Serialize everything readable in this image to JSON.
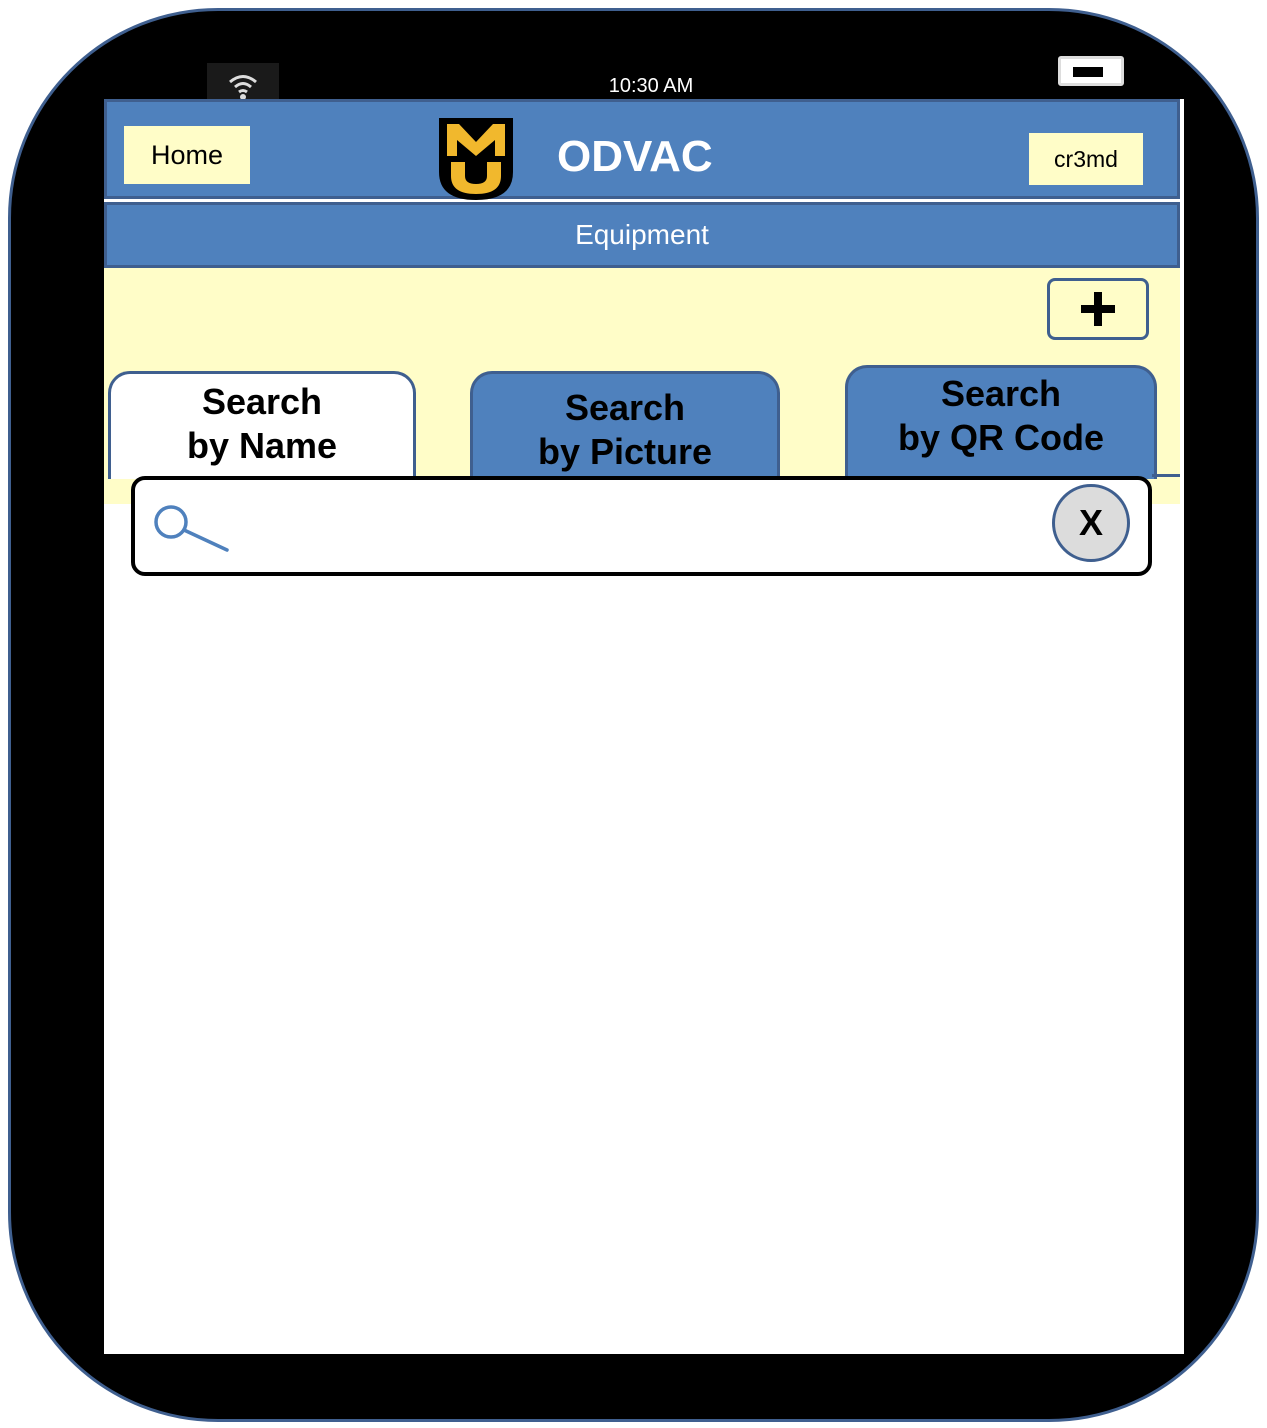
{
  "status_bar": {
    "time": "10:30 AM",
    "wifi_icon": "wifi-icon",
    "battery_icon": "battery-icon"
  },
  "header": {
    "home_label": "Home",
    "logo_icon": "mu-logo-icon",
    "logo_text": "MU",
    "title": "ODVAC",
    "user_label": "cr3md"
  },
  "subheader": {
    "title": "Equipment"
  },
  "toolbar": {
    "add_icon": "plus-icon"
  },
  "tabs": [
    {
      "line1": "Search",
      "line2": "by Name",
      "active": true
    },
    {
      "line1": "Search",
      "line2": "by Picture",
      "active": false
    },
    {
      "line1": "Search",
      "line2": "by QR Code",
      "active": false
    }
  ],
  "search": {
    "value": "",
    "placeholder": "",
    "search_icon": "search-icon",
    "clear_label": "X"
  },
  "colors": {
    "header_blue": "#4f81bd",
    "border_blue": "#3f5f8f",
    "cream": "#fffdc8",
    "mu_gold": "#f1b82d"
  }
}
